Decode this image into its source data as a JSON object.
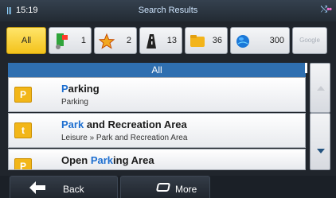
{
  "status_bar": {
    "time": "15:19",
    "title": "Search Results"
  },
  "filters": [
    {
      "label": "All",
      "count": "",
      "icon": "all-tab"
    },
    {
      "label": "",
      "count": "1",
      "icon": "map-pin-icon"
    },
    {
      "label": "",
      "count": "2",
      "icon": "star-icon"
    },
    {
      "label": "",
      "count": "13",
      "icon": "road-icon"
    },
    {
      "label": "",
      "count": "36",
      "icon": "folder-icon"
    },
    {
      "label": "",
      "count": "300",
      "icon": "globe-icon"
    },
    {
      "label": "Google",
      "count": "",
      "icon": "google-logo"
    }
  ],
  "list": {
    "header": "All",
    "items": [
      {
        "name_highlight": "P",
        "name_rest": "arking",
        "subtitle": "Parking",
        "icon_letter": "P"
      },
      {
        "name_highlight": "Park",
        "name_rest": " and Recreation Area",
        "subtitle": "Leisure » Park and Recreation Area",
        "icon_letter": "t"
      },
      {
        "name_prefix": "Open ",
        "name_highlight": "Park",
        "name_rest": "ing Area",
        "subtitle": "",
        "icon_letter": "P"
      }
    ]
  },
  "bottom_bar": {
    "back_label": "Back",
    "more_label": "More"
  },
  "colors": {
    "accent": "#2f6fb0",
    "highlight": "#1e6fd0",
    "active_tab": "#f3c21b",
    "category": "#f2b618"
  }
}
